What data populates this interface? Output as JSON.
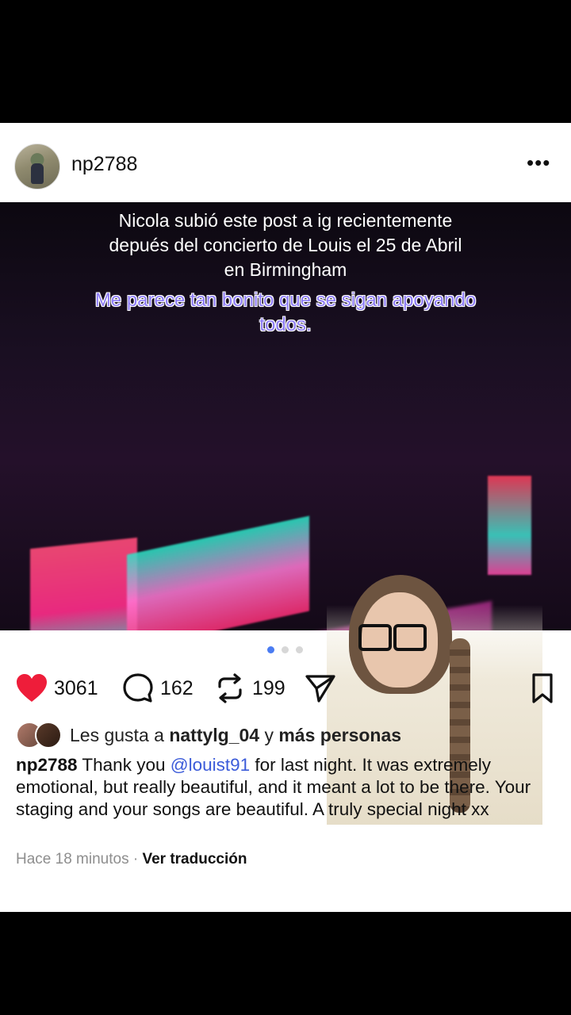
{
  "post": {
    "username": "np2788",
    "more_icon": "more-horizontal-icon",
    "overlay": {
      "line1": "Nicola subió este post a ig recientemente",
      "line2": "depués del concierto de Louis el 25 de Abril",
      "line3": "en Birmingham",
      "accent_line1": "Me parece tan bonito que se sigan apoyando",
      "accent_line2": "todos."
    },
    "carousel": {
      "count": 3,
      "active": 1
    },
    "actions": {
      "likes": "3061",
      "comments": "162",
      "reposts": "199"
    },
    "liked_by": {
      "prefix": "Les gusta a",
      "user": "nattylg_04",
      "joiner": "y",
      "suffix": "más personas"
    },
    "caption": {
      "author": "np2788",
      "pre": "Thank you",
      "mention": "@louist91",
      "post": "for last night. It was extremely emotional, but really beautiful, and it meant a lot to be there. Your staging and your songs are beautiful. A truly special night xx"
    },
    "meta": {
      "time": "Hace 18 minutos",
      "separator": "·",
      "translate": "Ver traducción"
    }
  },
  "colors": {
    "heart": "#ee1d3a",
    "accent_text": "#8d7cf5",
    "mention": "#3b5bd9",
    "dot_active": "#4a7cf2"
  }
}
